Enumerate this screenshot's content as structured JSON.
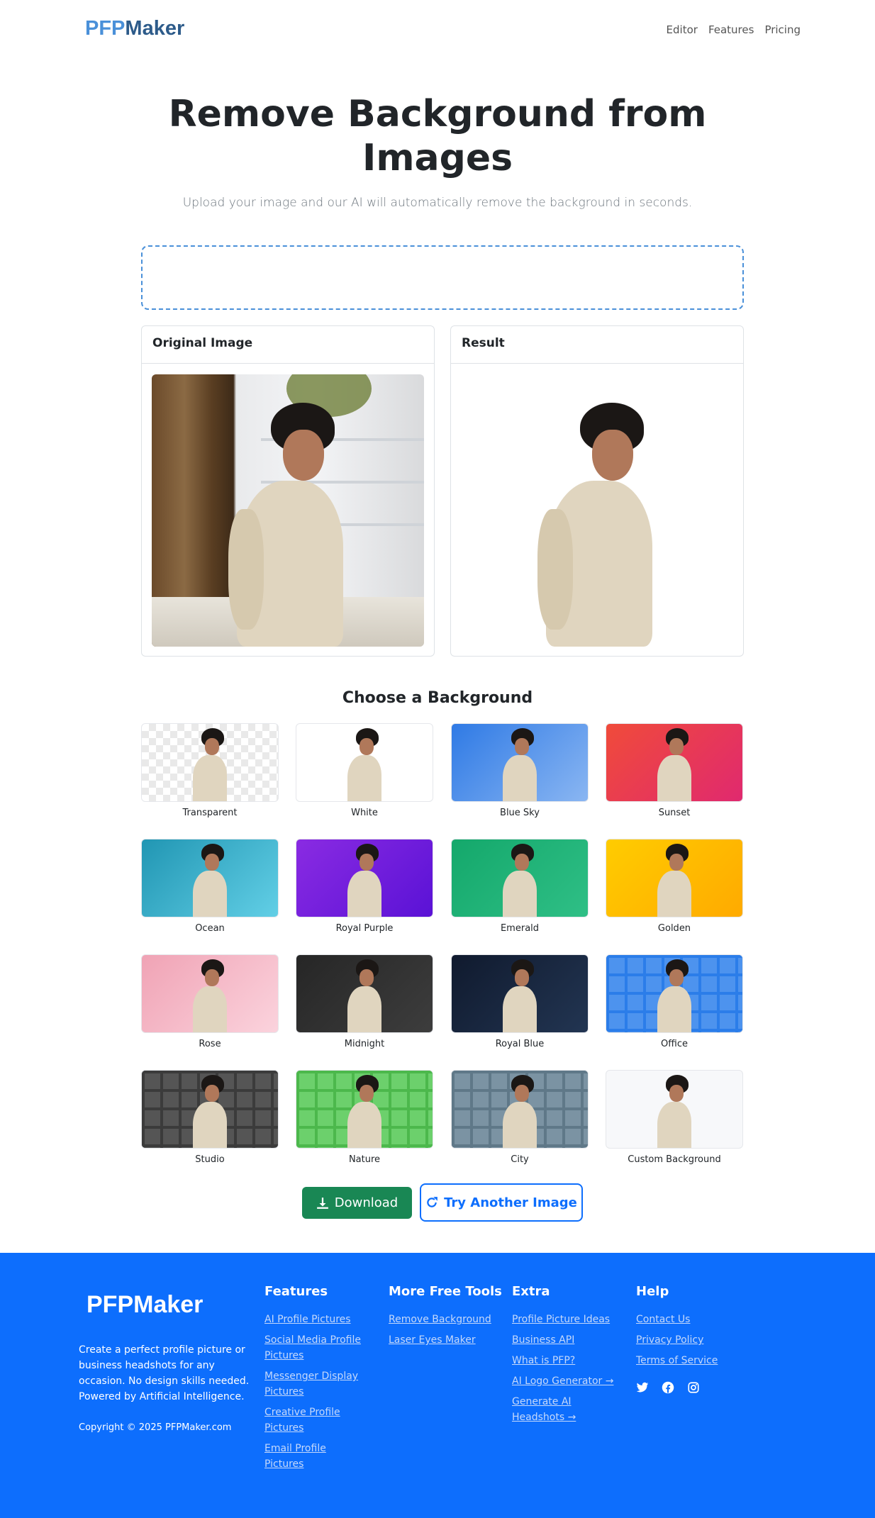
{
  "brand": {
    "logo_part1": "PFP",
    "logo_part2": "Maker"
  },
  "nav": {
    "links": [
      "Editor",
      "Features",
      "Pricing"
    ]
  },
  "hero": {
    "title_line1": "Remove Background from",
    "title_line2": "Images",
    "subtitle": "Upload your image and our AI will automatically remove the background in seconds."
  },
  "panels": {
    "original_title": "Original Image",
    "result_title": "Result"
  },
  "backgrounds": {
    "title": "Choose a Background",
    "items": [
      {
        "label": "Transparent",
        "style": "checker"
      },
      {
        "label": "White",
        "style": "#ffffff"
      },
      {
        "label": "Blue Sky",
        "style": "linear-gradient(135deg,#2f7ae5,#8ab6f2)"
      },
      {
        "label": "Sunset",
        "style": "linear-gradient(135deg,#f04b3a,#e0296f)"
      },
      {
        "label": "Ocean",
        "style": "linear-gradient(135deg,#2196b3,#62cfe6)"
      },
      {
        "label": "Royal Purple",
        "style": "linear-gradient(135deg,#8a2be2,#5a12d6)"
      },
      {
        "label": "Emerald",
        "style": "linear-gradient(135deg,#14a86b,#2fbf86)"
      },
      {
        "label": "Golden",
        "style": "linear-gradient(135deg,#ffcc00,#ffaa00)"
      },
      {
        "label": "Rose",
        "style": "linear-gradient(135deg,#f0a3b5,#fbd3dd)"
      },
      {
        "label": "Midnight",
        "style": "linear-gradient(135deg,#262626,#3d3d3d)"
      },
      {
        "label": "Royal Blue",
        "style": "linear-gradient(135deg,#101a2e,#223552)"
      },
      {
        "label": "Office",
        "style": "tiles:#2b7de9:#4d93ee"
      },
      {
        "label": "Studio",
        "style": "tiles:#3b3b3b:#555555"
      },
      {
        "label": "Nature",
        "style": "tiles:#4cb84c:#6cd06c"
      },
      {
        "label": "City",
        "style": "tiles:#5f7888:#7b93a3"
      },
      {
        "label": "Custom Background",
        "style": "#f7f8fa"
      }
    ]
  },
  "actions": {
    "download": "Download",
    "try_another": "Try Another Image"
  },
  "footer": {
    "logo": "PFPMaker",
    "description": "Create a perfect profile picture or business headshots for any occasion. No design skills needed. Powered by Artificial Intelligence.",
    "copyright": "Copyright © 2025 PFPMaker.com",
    "columns": [
      {
        "title": "Features",
        "links": [
          "AI Profile Pictures",
          "Social Media Profile Pictures",
          "Messenger Display Pictures",
          "Creative Profile Pictures",
          "Email Profile Pictures"
        ]
      },
      {
        "title": "More Free Tools",
        "links": [
          "Remove Background",
          "Laser Eyes Maker"
        ]
      },
      {
        "title": "Extra",
        "links": [
          "Profile Picture Ideas",
          "Business API",
          "What is PFP?",
          "AI Logo Generator →",
          "Generate AI Headshots →"
        ]
      },
      {
        "title": "Help",
        "links": [
          "Contact Us",
          "Privacy Policy",
          "Terms of Service"
        ]
      }
    ],
    "social_icons": [
      "twitter-icon",
      "facebook-icon",
      "instagram-icon"
    ]
  }
}
